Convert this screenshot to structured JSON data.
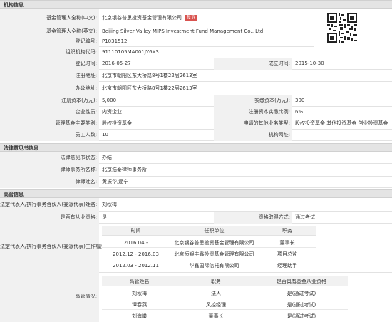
{
  "sections": {
    "org": "机构信息",
    "legal": "法律意见书信息",
    "exec": "高管信息"
  },
  "org": {
    "cn_name_label": "基金管理人全称(中文):",
    "cn_name_value": "北京银谷普思投资基金管理有限公司",
    "complain_label": "投诉",
    "en_name_label": "基金管理人全称(英文):",
    "en_name_value": "Beijing Silver Valley MIPS Investment Fund Management Co., Ltd.",
    "reg_no_label": "登记编号:",
    "reg_no_value": "P1031512",
    "org_code_label": "组织机构代码:",
    "org_code_value": "91110105MA001JY6X3",
    "reg_time_label": "登记时间:",
    "reg_time_value": "2016-05-27",
    "est_time_label": "成立时间:",
    "est_time_value": "2015-10-30",
    "reg_addr_label": "注册地址:",
    "reg_addr_value": "北京市朝阳区东大桥路8号1楼22层2613室",
    "office_addr_label": "办公地址:",
    "office_addr_value": "北京市朝阳区东大桥路8号1楼22层2613室",
    "reg_cap_label": "注册资本(万元):",
    "reg_cap_value": "5,000",
    "paid_cap_label": "实缴资本(万元):",
    "paid_cap_value": "300",
    "nature_label": "企业性质:",
    "nature_value": "内资企业",
    "paid_ratio_label": "注册资本实缴比例:",
    "paid_ratio_value": "6%",
    "biz_type_label": "管理基金主要类别:",
    "biz_type_value": "股权投资基金",
    "other_biz_label": "申请的其他业务类型:",
    "other_biz_value": "股权投资基金 其他投资基金 创业投资基金",
    "staff_label": "员工人数:",
    "staff_value": "10",
    "website_label": "机构网址:",
    "website_value": ""
  },
  "legal": {
    "status_label": "法律意见书状态:",
    "status_value": "办结",
    "firm_label": "律师事务所名称:",
    "firm_value": "北京浩泰律师事务所",
    "lawyer_label": "律师姓名:",
    "lawyer_value": "黄振华,逯宁"
  },
  "exec": {
    "rep_label": "法定代表人/执行事务合伙人(委派代表)姓名:",
    "rep_value": "刘秋梅",
    "qualified_label": "是否有从业资格:",
    "qualified_value": "是",
    "qual_method_label": "资格取得方式:",
    "qual_method_value": "通过考试",
    "work_label": "法定代表人/执行事务合伙人(委派代表)工作履历:",
    "work_headers": [
      "时间",
      "任职单位",
      "职务"
    ],
    "work_rows": [
      [
        "2016.04 -",
        "北京银谷普思投资基金管理有限公司",
        "董事长"
      ],
      [
        "2012.12 - 2016.03",
        "北京恒银丰鑫投资基金管理有限公司",
        "项目总监"
      ],
      [
        "2012.03 - 2012.11",
        "华鑫国际信托有限公司",
        "经理助手"
      ]
    ],
    "mgr_label": "高管情况:",
    "mgr_headers": [
      "高管姓名",
      "职务",
      "是否具有基金从业资格"
    ],
    "mgr_rows": [
      [
        "刘秋梅",
        "法人",
        "是(通过考试)"
      ],
      [
        "谭春燕",
        "风控经理",
        "是(通过考试)"
      ],
      [
        "刘海曦",
        "董事长",
        "是(通过考试)"
      ]
    ]
  },
  "icons": {
    "qr": "qr-code-icon"
  }
}
